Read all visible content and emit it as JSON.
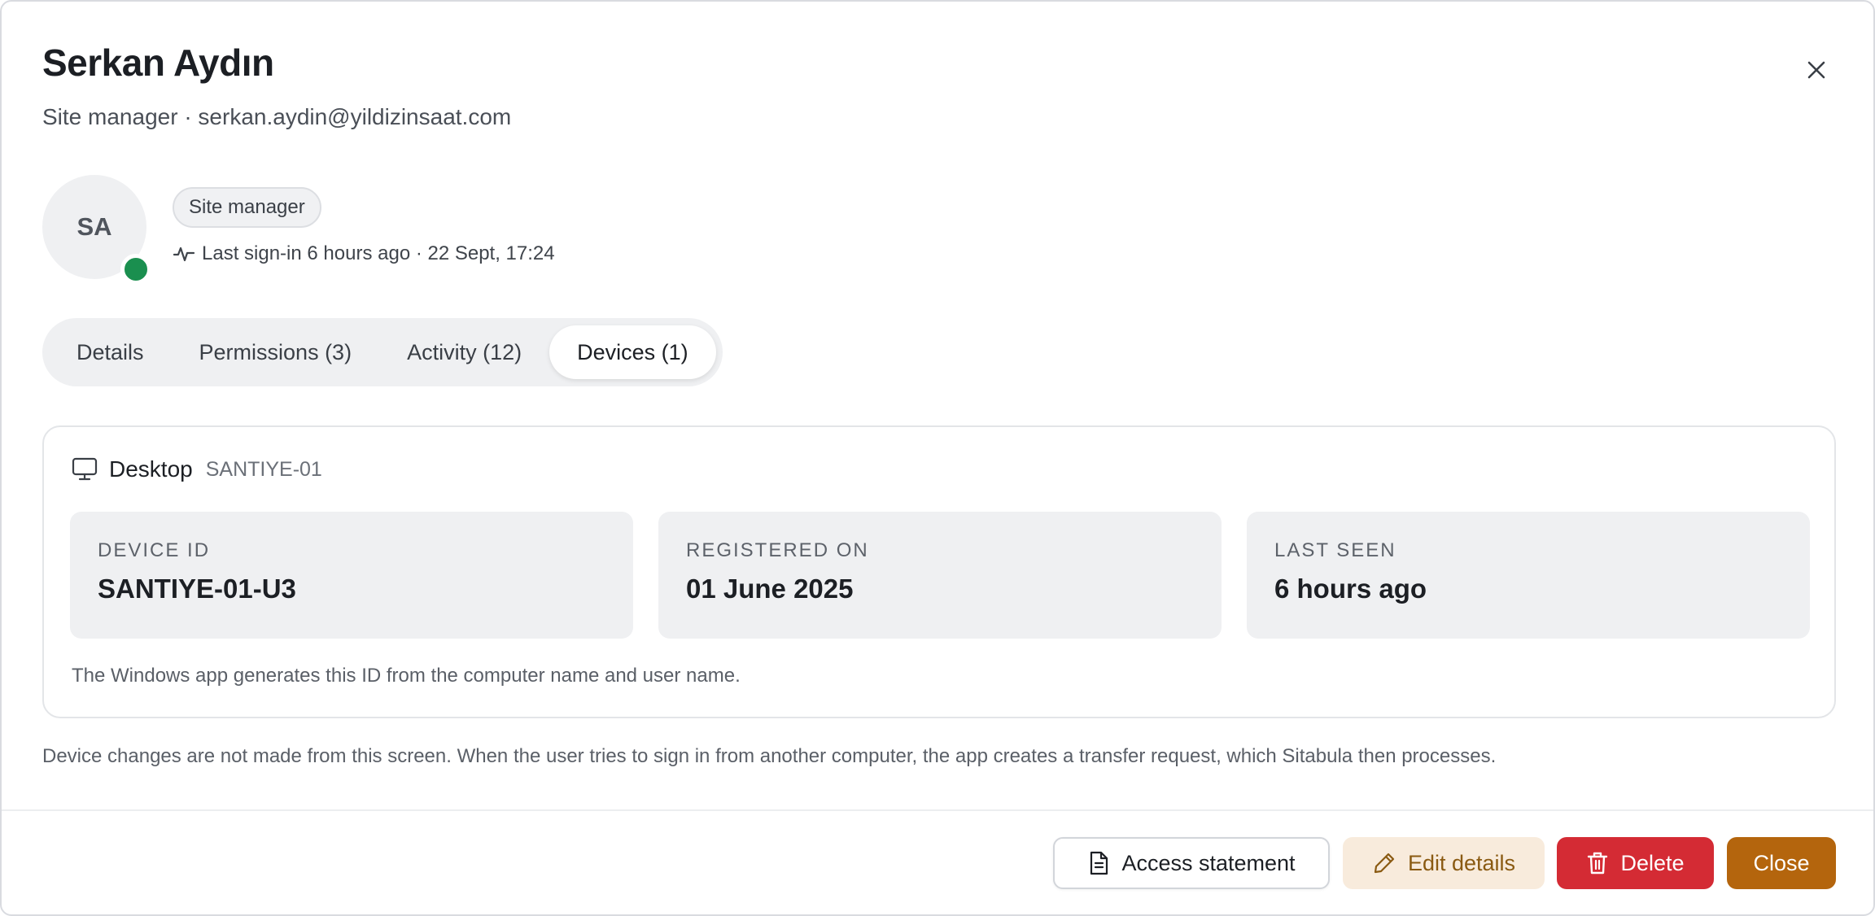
{
  "user": {
    "name": "Serkan Aydın",
    "subtitle": "Site manager · serkan.aydin@yildizinsaat.com",
    "initials": "SA",
    "role_chip": "Site manager",
    "last_signin": "Last sign-in 6 hours ago · 22 Sept, 17:24",
    "status_color": "#1a8f4f"
  },
  "tabs": [
    {
      "label": "Details",
      "active": false
    },
    {
      "label": "Permissions (3)",
      "active": false
    },
    {
      "label": "Activity (12)",
      "active": false
    },
    {
      "label": "Devices (1)",
      "active": true
    }
  ],
  "device": {
    "type": "Desktop",
    "name": "SANTIYE-01",
    "fields": [
      {
        "label": "DEVICE ID",
        "value": "SANTIYE-01-U3"
      },
      {
        "label": "REGISTERED ON",
        "value": "01 June 2025"
      },
      {
        "label": "LAST SEEN",
        "value": "6 hours ago"
      }
    ],
    "note": "The Windows app generates this ID from the computer name and user name."
  },
  "footnote": "Device changes are not made from this screen. When the user tries to sign in from another computer, the app creates a transfer request, which Sitabula then processes.",
  "buttons": {
    "access_statement": "Access statement",
    "edit_details": "Edit details",
    "delete": "Delete",
    "close": "Close"
  },
  "colors": {
    "danger": "#d42b34",
    "primary": "#b4650d",
    "edit_bg": "#f8ebdc"
  }
}
